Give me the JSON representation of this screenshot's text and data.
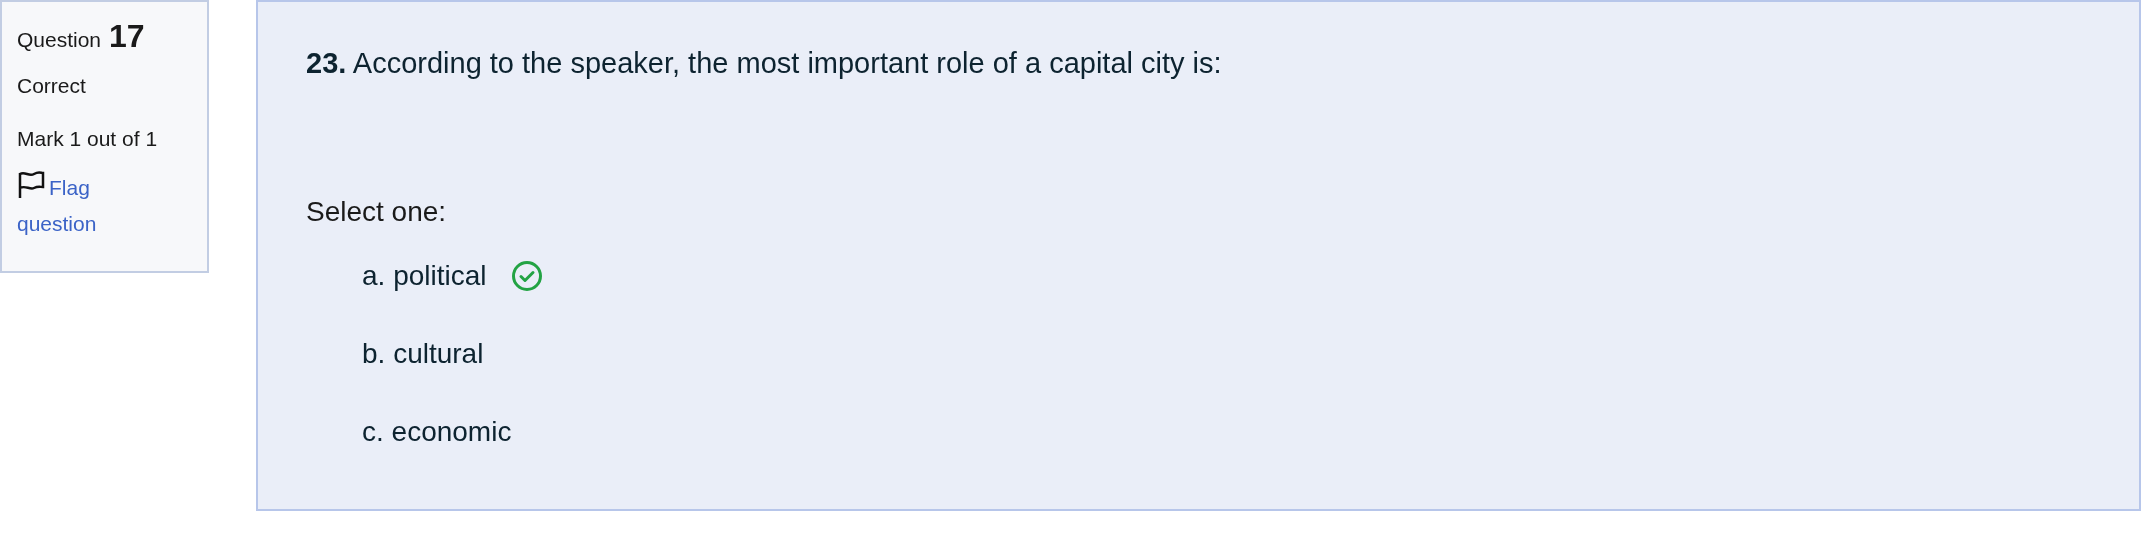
{
  "info": {
    "label": "Question",
    "number": "17",
    "status": "Correct",
    "mark": "Mark 1 out of 1",
    "flag_link": "Flag question"
  },
  "question": {
    "number": "23.",
    "text": "According to the speaker, the most important role of a capital city is:",
    "prompt": "Select one:",
    "options": [
      {
        "label": "a. political",
        "correct": true
      },
      {
        "label": "b. cultural",
        "correct": false
      },
      {
        "label": "c. economic",
        "correct": false
      }
    ]
  }
}
